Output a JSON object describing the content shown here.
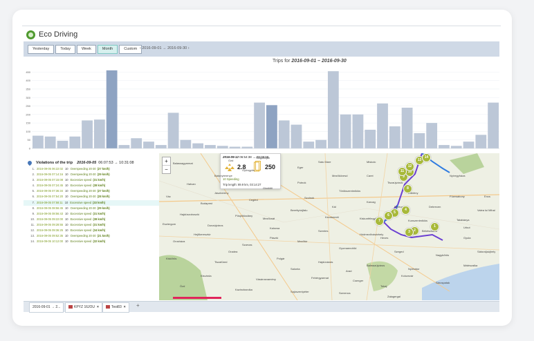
{
  "app": {
    "title": "Eco Driving"
  },
  "toolbar": {
    "buttons": [
      {
        "label": "Yesterday",
        "active": false
      },
      {
        "label": "Today",
        "active": false
      },
      {
        "label": "Week",
        "active": false
      },
      {
        "label": "Month",
        "active": true
      },
      {
        "label": "Custom",
        "active": false
      }
    ],
    "range_text": "2016-09-01 → 2016-09-30",
    "prev_icon": "chevron-left-icon",
    "next_icon": "chevron-right-icon"
  },
  "chart_data": {
    "type": "bar",
    "title_prefix": "Trips for",
    "title_range": "2016-09-01 – 2016-09-30",
    "ylim": [
      0,
      480
    ],
    "yticks": [
      "0",
      "50",
      "100",
      "150",
      "200",
      "250",
      "300",
      "350",
      "400",
      "450"
    ],
    "values": [
      75,
      70,
      45,
      70,
      165,
      170,
      460,
      20,
      60,
      40,
      20,
      210,
      50,
      30,
      20,
      15,
      10,
      10,
      270,
      255,
      165,
      140,
      40,
      50,
      455,
      200,
      200,
      110,
      265,
      130,
      240,
      90,
      150,
      20,
      15,
      40,
      80,
      270
    ],
    "highlighted": [
      6,
      19
    ],
    "color": "#bcc7d7",
    "highlight_color": "#8ea3c2"
  },
  "violations": {
    "title": "Violations of the trip",
    "date": "2016-09-05",
    "time": "06:07:53 → 10:31:08",
    "rows": [
      {
        "n": "1.",
        "datetime": "2016-09-05 06:22:02",
        "speed": "10",
        "type": "Overspeeding 20-30",
        "detail": "(27 km/h)"
      },
      {
        "n": "2.",
        "datetime": "2016-09-05 07:14:16",
        "speed": "10",
        "type": "Overspeeding 20-30",
        "detail": "(29 km/h)"
      },
      {
        "n": "3.",
        "datetime": "2016-09-05 07:15:08",
        "speed": "10",
        "type": "Excessive speed",
        "detail": "(31 km/h)"
      },
      {
        "n": "4.",
        "datetime": "2016-09-05 07:24:45",
        "speed": "10",
        "type": "Excessive speed",
        "detail": "(38 km/h)"
      },
      {
        "n": "5.",
        "datetime": "2016-09-05 07:36:34",
        "speed": "10",
        "type": "Overspeeding 20-30",
        "detail": "(27 km/h)"
      },
      {
        "n": "6.",
        "datetime": "2016-09-05 07:54:20",
        "speed": "10",
        "type": "Overspeeding 20-30",
        "detail": "(28 km/h)"
      },
      {
        "n": "7.",
        "datetime": "2016-09-05 07:58:11",
        "speed": "10",
        "type": "Excessive speed",
        "detail": "(33 km/h)"
      },
      {
        "n": "8.",
        "datetime": "2016-09-05 08:56:45",
        "speed": "10",
        "type": "Overspeeding 20-30",
        "detail": "(29 km/h)"
      },
      {
        "n": "9.",
        "datetime": "2016-09-05 08:56:43",
        "speed": "10",
        "type": "Excessive speed",
        "detail": "(31 km/h)"
      },
      {
        "n": "10.",
        "datetime": "2016-09-05 09:22:00",
        "speed": "10",
        "type": "Excessive speed",
        "detail": "(38 km/h)"
      },
      {
        "n": "11.",
        "datetime": "2016-09-05 09:28:55",
        "speed": "10",
        "type": "Excessive speed",
        "detail": "(31 km/h)"
      },
      {
        "n": "12.",
        "datetime": "2016-09-05 09:36:25",
        "speed": "10",
        "type": "Excessive speed",
        "detail": "(34 km/h)"
      },
      {
        "n": "13.",
        "datetime": "2016-09-05 09:52:35",
        "speed": "10",
        "type": "Overspeeding 20-30",
        "detail": "(21 km/h)"
      },
      {
        "n": "14.",
        "datetime": "2016-09-05 10:12:00",
        "speed": "10",
        "type": "Excessive speed",
        "detail": "(32 km/h)"
      }
    ],
    "highlight_row": 6
  },
  "map": {
    "zoom_in": "+",
    "zoom_out": "−",
    "popup": {
      "date": "2016-09-12",
      "time": "06:54:38 → 09:09:58",
      "score": "2.8",
      "count": "250",
      "category_num": "10",
      "category": "Speeding",
      "length": "Trip length: 89.9 km, 03:14:27"
    },
    "labels": [
      "Ozd",
      "Salgótarján",
      "Balassagyarmat",
      "Gyöngyös",
      "Eger",
      "Mezőkövesd",
      "Miskolc",
      "Tiszaújváros",
      "Nyíregyháza",
      "Hatvan",
      "Jászberény",
      "Gödöllő",
      "Vác",
      "Budapest",
      "Cegléd",
      "Szolnok",
      "Törökszentmiklós",
      "Karcag",
      "Debrecen",
      "Hajdúszoboszló",
      "Püspökladány",
      "Berettyóújfalu",
      "Kecskemét",
      "Kiskunfélegyháza",
      "Kunszentmiklós",
      "Tatabánya",
      "Esztergom",
      "Dunaújváros",
      "Kalocsa",
      "Szentes",
      "Hódmezővásárhely",
      "Békéscsaba",
      "Gyula",
      "Orosháza",
      "Szarvas",
      "Mezőtúr",
      "Gyomaendrőd",
      "Szeged",
      "Nagykőrös",
      "Kiskőrös",
      "Tiszafüred",
      "Polgár",
      "Hajdúnánás",
      "Balmazújváros",
      "Nyírbátor",
      "Mátészalka",
      "Kisvárda",
      "Vásárosnamény",
      "Fehérgyarmat",
      "Csenger",
      "Ózd",
      "Kazincbarcika",
      "Sajószentpéter",
      "Szerencs",
      "Tokaj",
      "Sárospatak",
      "Sátoraljaújhely",
      "Encs",
      "Edelény",
      "Putnok",
      "Bátonyterenye",
      "Pásztó",
      "Heves",
      "Füzesabony",
      "Kál",
      "Mezőcsát",
      "Hejőkeresztúr",
      "Nyírlugos",
      "Oradea",
      "Salonta",
      "Arad",
      "Kolozsvár",
      "Urkut",
      "Valea lui Mihai",
      "Carei",
      "Satu Mare",
      "Zalagergal"
    ],
    "markers": [
      "1",
      "2",
      "3",
      "4",
      "5",
      "6",
      "7",
      "8",
      "9",
      "10",
      "11",
      "12",
      "13",
      "14"
    ]
  },
  "tabs": [
    {
      "label": "2016-09-01 → 2...",
      "icon": ""
    },
    {
      "label": "KPYZ 16JOU",
      "icon": "vehicle-icon"
    },
    {
      "label": "Test83",
      "icon": "phone-icon"
    }
  ],
  "add_tab": "+"
}
